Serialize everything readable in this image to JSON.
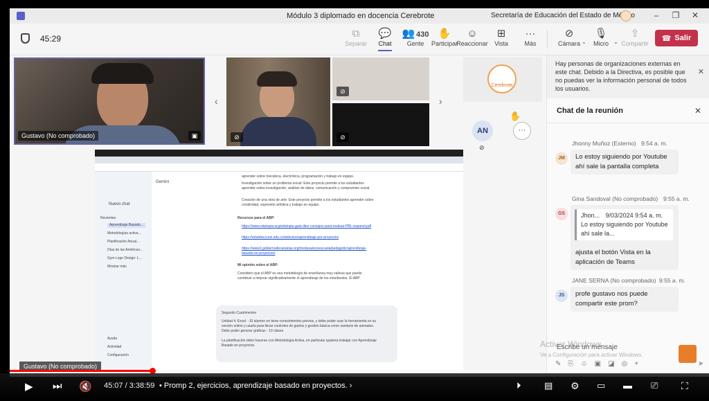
{
  "window": {
    "title": "Módulo 3 diplomado en docencia Cerebrote",
    "org": "Secretaría de Educación del Estado de México"
  },
  "toolbar": {
    "timer": "45:29",
    "separate": "Separar",
    "chat": "Chat",
    "people": "Gente",
    "people_count": "430",
    "participate": "Participar",
    "react": "Reaccionar",
    "view": "Vista",
    "more": "Más",
    "camera": "Cámara",
    "mic": "Micro",
    "share": "Compartir",
    "leave": "Salir"
  },
  "video": {
    "main_tile_label": "Gustavo (No comprobado)",
    "share_label": "Gustavo (No comprobado)",
    "an_initials": "AN",
    "org_logo_text": "Cerebrote"
  },
  "screen_share": {
    "app_name": "Gemini",
    "new_chat": "Nuevo chat",
    "recent": "Recientes",
    "recent_items": [
      "Aprendizaje Basado...",
      "Metodologías activa...",
      "Planificación Anual...",
      "Días de las Américas...",
      "Gym Logo Design: L...",
      "Mostrar más"
    ],
    "bottom_items": [
      "Ayuda",
      "Actividad",
      "Configuración"
    ],
    "bullets": [
      "aprender sobre mecánica, electrónica, programación y trabajo en equipo.",
      "Investigación sobre un problema social: Este proyecto permite a los estudiantes aprender sobre investigación, análisis de datos, comunicación y compromiso social.",
      "Creación de una obra de arte: Este proyecto permite a los estudiantes aprender sobre creatividad, expresión artística y trabajo en equipo."
    ],
    "resources_title": "Recursos para el ABP:",
    "links": [
      "https://www.edutopia.org/edutopia-guia-diez-consejos-para-evaluar-PBL-espanol.pdf",
      "https://eduteka.icesi.edu.co/articulos/aprendizaje-por-proyectos",
      "https://www3.gobiernodecanarias.org/medusa/ecoescuela/pedagotic/aprendizaje-basado-en-proyectos/"
    ],
    "opinion_title": "Mi opinión sobre el ABP:",
    "opinion_text": "Considero que el ABP es una metodología de enseñanza muy valiosa que puede contribuir a mejorar significativamente el aprendizaje de los estudiantes. El ABP",
    "prompt_title": "Segundo Cuatrimestre",
    "prompt_text": "Unidad 4: Excel. - El alumno no tiene conocimientos previos, y debe poder usar la herramienta en su versión online y usarla para llevar controles de gastos y gestión básica como sanitario de animales. Debe poder generar gráficas - 10 clases",
    "prompt_text2": "La planificación debe hacerse con Metodología Activa, en particular quisiera trabajar con Aprendizaje Basado en proyectos."
  },
  "chat": {
    "notice": "Hay personas de organizaciones externas en este chat. Debido a la Directiva, es posible que no puedas ver la información personal de todos los usuarios.",
    "title": "Chat de la reunión",
    "messages": [
      {
        "author": "Jhonny Muñoz (Externo)",
        "time": "9:54 a. m.",
        "initials": "JM",
        "text": "Lo estoy siguiendo por Youtube ahí sale la pantalla completa"
      },
      {
        "author": "Gina Sandoval (No comprobado)",
        "time": "9:55 a. m.",
        "initials": "GS",
        "quote_author": "Jhon...",
        "quote_time": "9/03/2024 9:54 a. m.",
        "quote_text": "Lo estoy siguiendo por Youtube ahí sale la...",
        "text": "ajusta el botón Vista en la aplicación de Teams"
      },
      {
        "author": "JANE SERNA (No comprobado)",
        "time": "9:55 a. m.",
        "initials": "JS",
        "text": "profe gustavo nos puede compartir este prom?"
      }
    ],
    "compose_placeholder": "Escribe un mensaje",
    "watermark": "Activar Windows",
    "watermark2": "Ve a Configuración para activar Windows."
  },
  "player": {
    "time": "45:07 / 3:38:59",
    "chapter": "Promp 2, ejercicios, aprendizaje basado en proyectos.",
    "progress_fraction": 0.206
  }
}
